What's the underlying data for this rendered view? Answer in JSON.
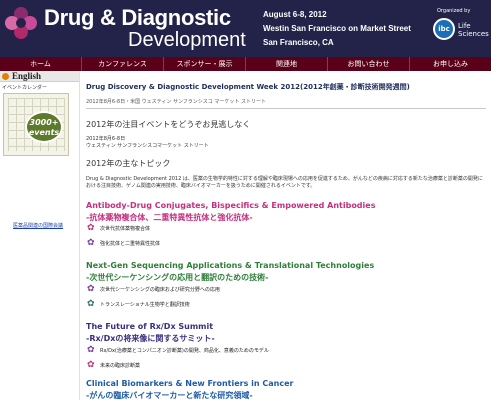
{
  "header": {
    "logo_line1": "Drug & Diagnostic",
    "logo_line2": "Development",
    "dates": "August 6-8, 2012",
    "venue": "Westin San Francisco on Market Street",
    "city": "San Francisco, CA",
    "organized_by": "Organized by",
    "org_logo": "ibc",
    "org_name_1": "Life",
    "org_name_2": "Sciences"
  },
  "nav": {
    "items": [
      "ホーム",
      "カンファレンス",
      "スポンサー・展示",
      "関連地",
      "お問い合わせ",
      "お申し込み"
    ]
  },
  "sidebar": {
    "language": "English",
    "calendar_title": "イベントカレンダー",
    "calendar_badge_line1": "3000+",
    "calendar_badge_line2": "events",
    "link": "医薬品関連の国際会議"
  },
  "main": {
    "title": "Drug Discovery & Diagnostic Development Week 2012(2012年創薬・診断技術開発週間)",
    "subtitle": "2012年8月6-8日・米国 ウェスティン サンフランシスコ マーケット ストリート",
    "section1": "2012年の注目イベントをどうぞお見逃しなく",
    "date_line1": "2012年8月6-8日",
    "date_line2": "ウェスティン サンフランシスコマーケット ストリート",
    "section2": "2012年の主なトピック",
    "intro": "Drug & Diagnostic Development 2012 は、医薬の生物学的特性に対する理解や臨床現場への応用を促進するため、がんなどの疾病に対応する新たな治療薬と診断薬の開発における注目技術、ゲノム関連の実用技術、臨床バイオマーカーを扱うために開催されるイベントです。"
  },
  "tracks": [
    {
      "title_en": "Antibody-Drug Conjugates, Bispecifics & Empowered Antibodies",
      "title_ja": "-抗体薬物複合体、二重特異性抗体と強化抗体-",
      "items": [
        "次世代抗体薬物複合体",
        "強化抗体と二重特異性抗体"
      ]
    },
    {
      "title_en": "Next-Gen Sequencing Applications & Translational Technologies",
      "title_ja": "-次世代シーケンシングの応用と翻訳のための技術-",
      "items": [
        "次世代シーケンシングの臨床および研究分野への応用",
        "トランスレーショナル生物学と翻訳技術"
      ]
    },
    {
      "title_en": "The Future of Rx/Dx Summit",
      "title_ja": "-Rx/Dxの将来像に関するサミット-",
      "items": [
        "Rx/Dx(治療薬とコンパニオン診断薬)の開発、商品化、意義のためのモデル",
        "未来の臨床診断薬"
      ]
    },
    {
      "title_en": "Clinical Biomarkers & New Frontiers in Cancer",
      "title_ja": "-がんの臨床バイオマーカーと新たな研究領域-",
      "items": []
    }
  ],
  "colors": {
    "header_bg": "#23234a",
    "nav_bg": "#5a0018",
    "track1_en": "#c3307e",
    "track1_ja": "#c3307e",
    "track2_en": "#2f7f3a",
    "track2_ja": "#2f7f3a",
    "track3_en": "#3a2e7e",
    "track3_ja": "#3a2e7e",
    "track4_en": "#1f5aa6",
    "track4_ja": "#1f5aa6"
  }
}
